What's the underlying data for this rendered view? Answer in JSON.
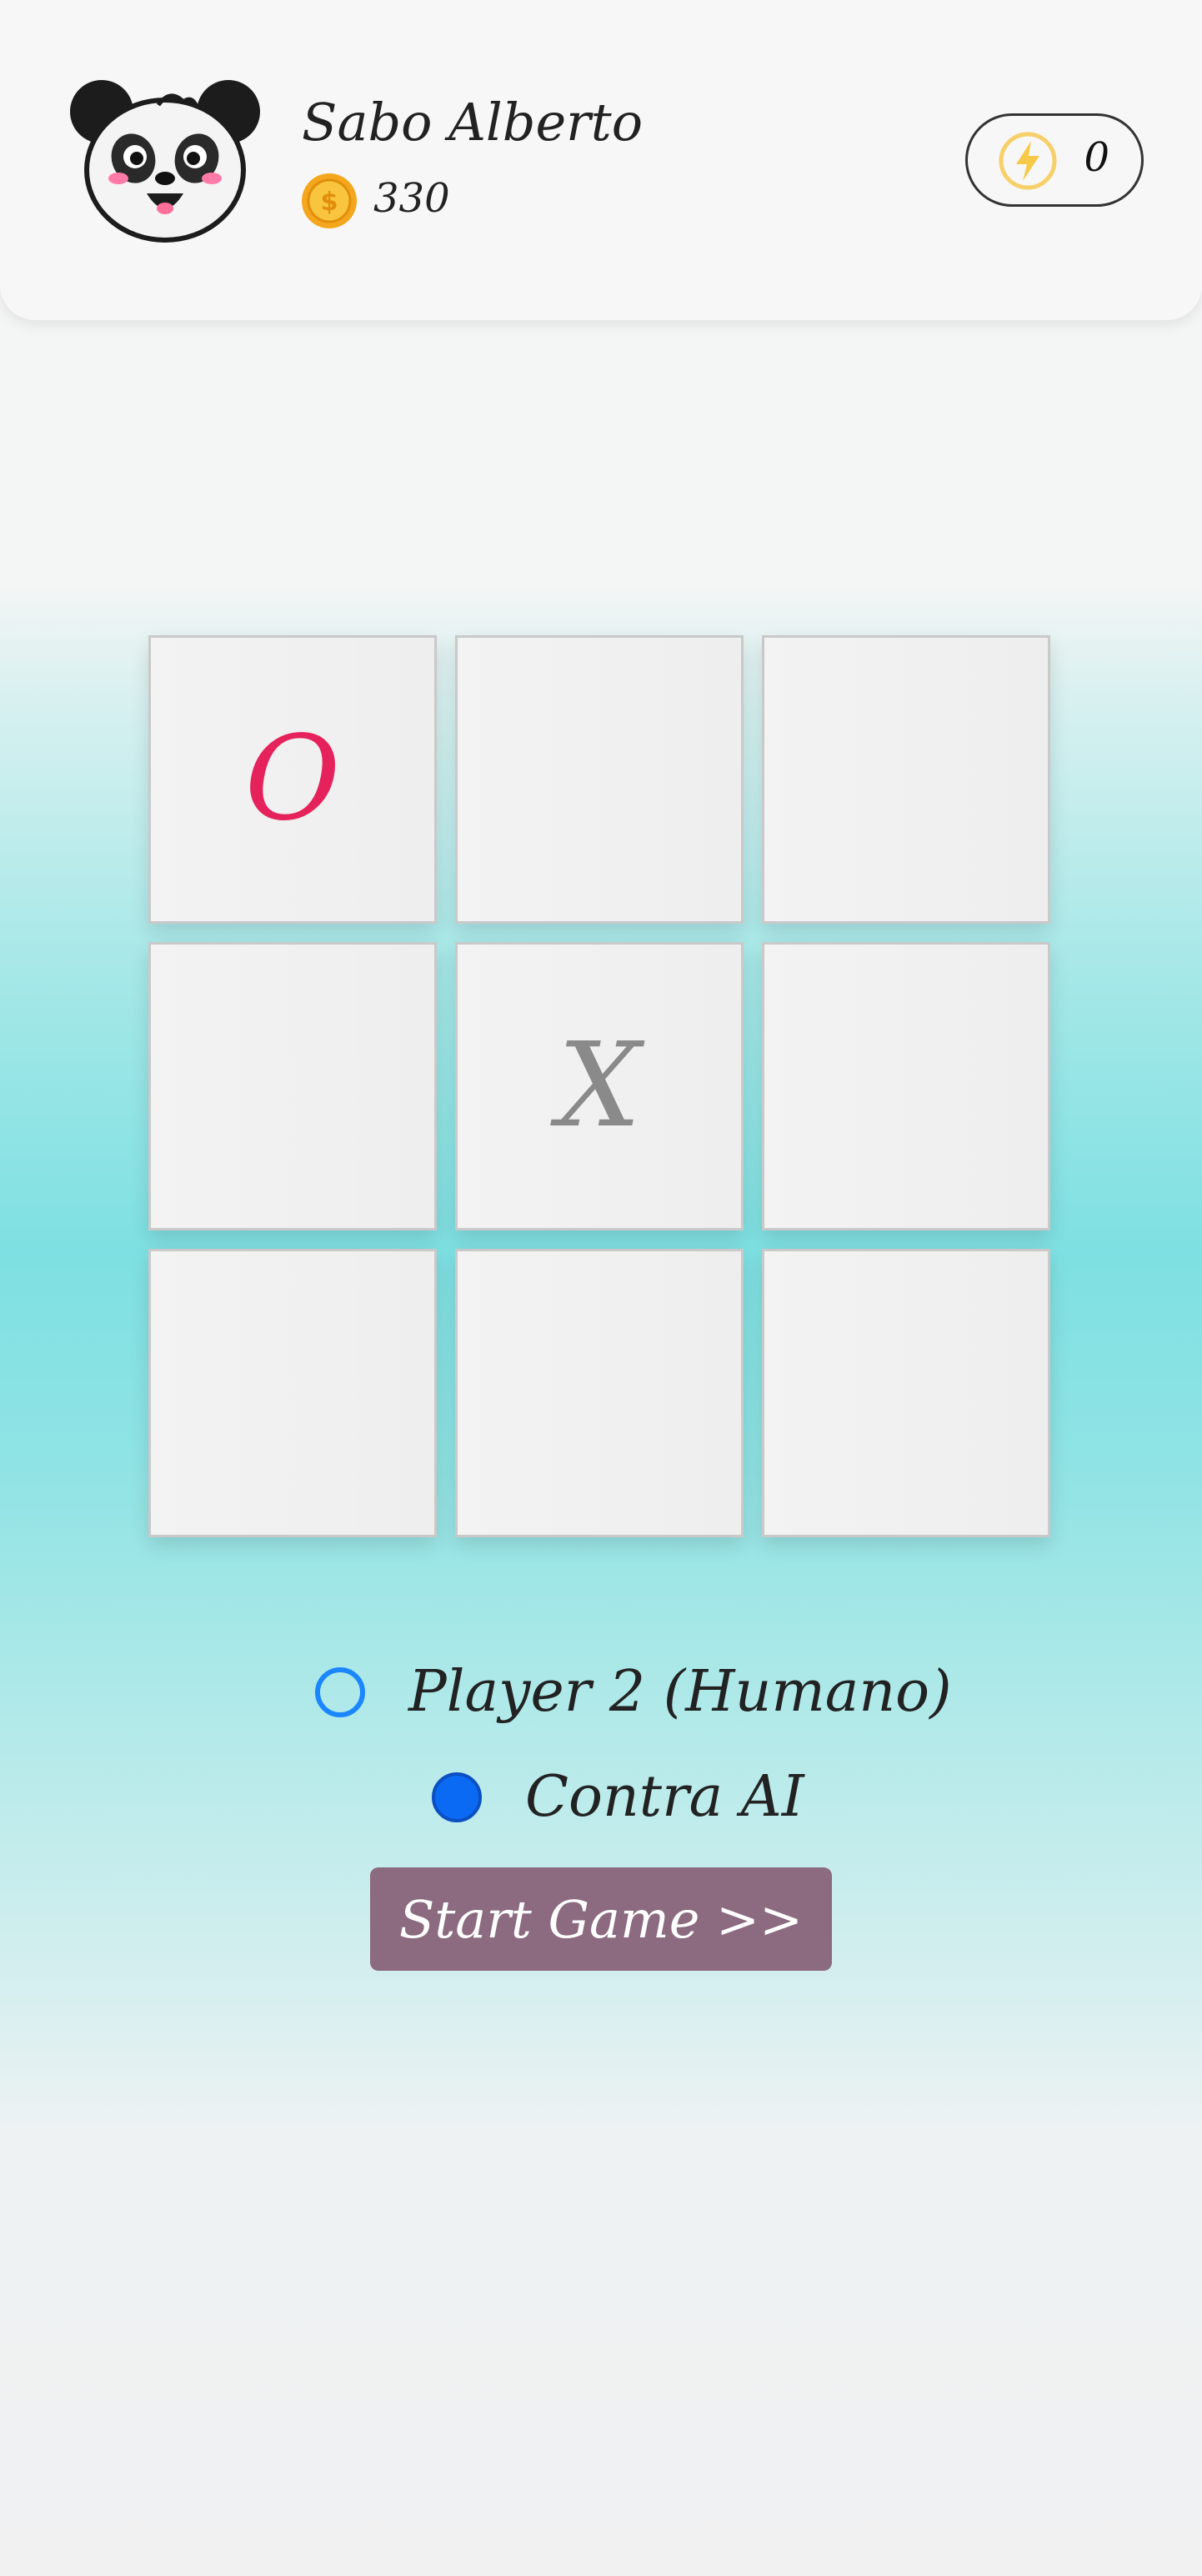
{
  "header": {
    "user_name": "Sabo Alberto",
    "coins": "330",
    "energy": "0"
  },
  "board": {
    "cells": [
      "O",
      "",
      "",
      "",
      "X",
      "",
      "",
      "",
      ""
    ]
  },
  "options": {
    "player2_label": "Player 2 (Humano)",
    "ai_label": "Contra AI",
    "selected": "ai"
  },
  "start_button": {
    "label": "Start Game >>"
  },
  "colors": {
    "o_mark": "#e5225b",
    "x_mark": "#8a8a8a",
    "button": "#8c6a80",
    "radio_selected": "#0a6af4",
    "radio_unselected": "#1a86ff"
  },
  "icons": {
    "avatar": "panda-avatar-icon",
    "coin": "coin-icon",
    "energy": "lightning-icon"
  }
}
